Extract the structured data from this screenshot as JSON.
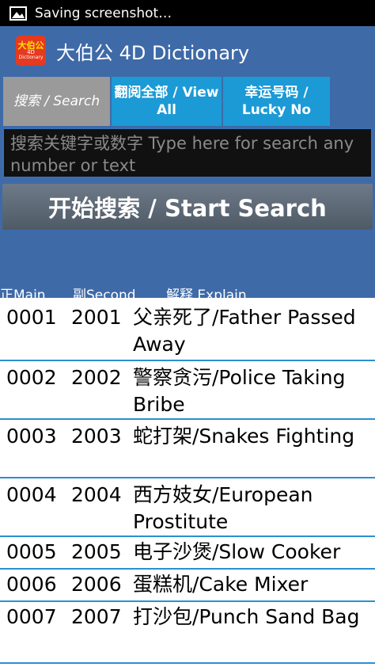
{
  "status": {
    "text": "Saving screenshot…",
    "icon": "image-icon"
  },
  "app": {
    "title": "大伯公 4D Dictionary",
    "logo": {
      "line1": "大伯公",
      "line2": "4D",
      "line3": "Dictionary"
    }
  },
  "tabs": {
    "search": "搜索 / Search",
    "view_all": "翻阅全部 / View All",
    "lucky": "幸运号码 / Lucky No"
  },
  "search": {
    "placeholder": "搜索关键字或数字 Type here for search any number or text"
  },
  "start_button": "开始搜索 / Start Search",
  "columns": {
    "main": "正Main",
    "second": "副Second",
    "explain": "解释 Explain"
  },
  "rows": [
    {
      "main": "0001",
      "second": "2001",
      "explain": "父亲死了/Father Passed Away"
    },
    {
      "main": "0002",
      "second": "2002",
      "explain": "警察贪污/Police Taking Bribe"
    },
    {
      "main": "0003",
      "second": "2003",
      "explain": "蛇打架/Snakes Fighting"
    },
    {
      "main": "0004",
      "second": "2004",
      "explain": "西方妓女/European Prostitute"
    },
    {
      "main": "0005",
      "second": "2005",
      "explain": "电子沙煲/Slow Cooker"
    },
    {
      "main": "0006",
      "second": "2006",
      "explain": "蛋糕机/Cake Mixer"
    },
    {
      "main": "0007",
      "second": "2007",
      "explain": "打沙包/Punch Sand Bag"
    }
  ]
}
